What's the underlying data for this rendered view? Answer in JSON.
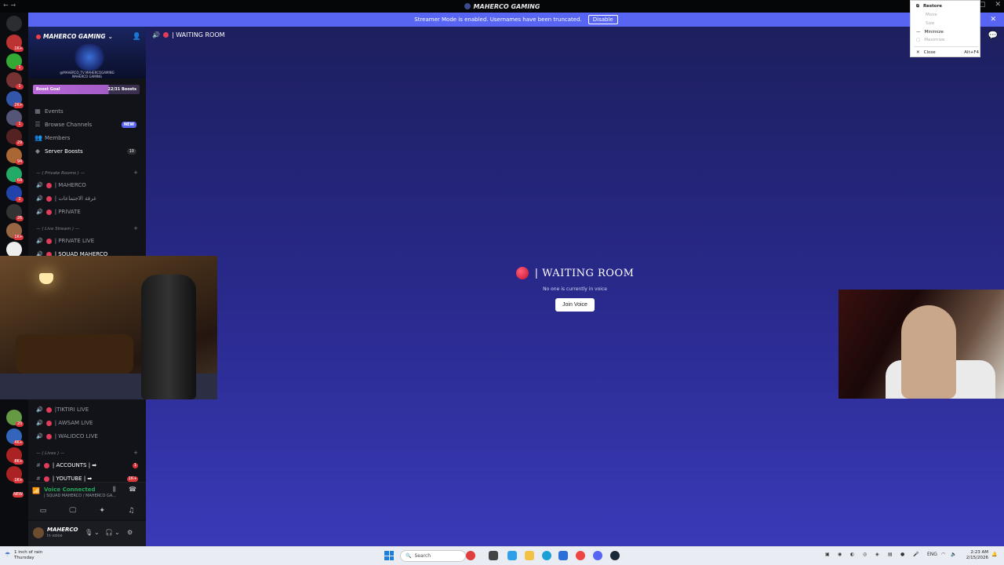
{
  "window": {
    "title": "MAHERCO GAMING",
    "nav": "← →",
    "controls": [
      "—",
      "▢",
      "✕"
    ]
  },
  "banner": {
    "text": "Streamer Mode is enabled. Usernames have been truncated.",
    "disable_label": "Disable"
  },
  "server_rail": {
    "badges": [
      "1K+",
      "1",
      "1",
      "2K+",
      "1",
      "29",
      "94",
      "64",
      "2",
      "26",
      "1K+",
      "20",
      "4K+",
      "8K+",
      "1K+",
      "NEW"
    ]
  },
  "server": {
    "name": "MAHERCO GAMING",
    "banner_caption": "@MAHERCO_TV  MAHERCOGAMING  MAHERCO GAMING",
    "boost_label": "Boost Goal",
    "boost_count": "22/31 Boosts",
    "boost_progress": 0.71
  },
  "nav_items": [
    {
      "label": "Events",
      "icon": "calendar-icon"
    },
    {
      "label": "Browse Channels",
      "icon": "browse-icon",
      "badge": "NEW"
    },
    {
      "label": "Members",
      "icon": "members-icon"
    },
    {
      "label": "Server Boosts",
      "icon": "boost-icon",
      "count": "10"
    }
  ],
  "categories": {
    "private": "— ( Private Rooms ) —",
    "live": "— ( Live Stream ) —",
    "lives": "— ( Lives ) —"
  },
  "private_channels": [
    "| MAHERCO",
    "| غرفة الاجتماعات",
    "| PRIVATE"
  ],
  "live_channels": [
    "| PRIVATE LIVE",
    "| SQUAD MAHERCO"
  ],
  "live_channels_2": [
    "|TIKTIRI LIVE",
    "| AWSAM LIVE",
    "| WALIDCO LIVE"
  ],
  "text_channels": [
    {
      "label": "| ACCOUNTS | ➡",
      "badge": "1"
    },
    {
      "label": "| YOUTUBE | ➡",
      "badge": "1K+"
    }
  ],
  "voice_panel": {
    "title": "Voice Connected",
    "channel": "| SQUAD MAHERCO / MAHERCO GA..."
  },
  "user": {
    "name": "MAHERCO",
    "status": "In voice"
  },
  "main": {
    "channel_name": "| WAITING ROOM",
    "center_title": "| WAITING ROOM",
    "center_sub": "No one is currently in voice",
    "join_label": "Join Voice"
  },
  "context_menu": {
    "items": [
      {
        "label": "Restore",
        "icon": "⧉",
        "enabled": true
      },
      {
        "label": "Move",
        "enabled": false
      },
      {
        "label": "Size",
        "enabled": false
      },
      {
        "label": "Minimize",
        "icon": "—",
        "enabled": true
      },
      {
        "label": "Maximize",
        "icon": "▢",
        "enabled": false
      },
      {
        "label": "Close",
        "icon": "✕",
        "shortcut": "Alt+F4",
        "enabled": true
      }
    ]
  },
  "taskbar": {
    "weather_line1": "1 inch of rain",
    "weather_line2": "Thursday",
    "search_placeholder": "Search",
    "language": "ENG",
    "time": "2:23 AM",
    "date": "2/15/2026"
  }
}
